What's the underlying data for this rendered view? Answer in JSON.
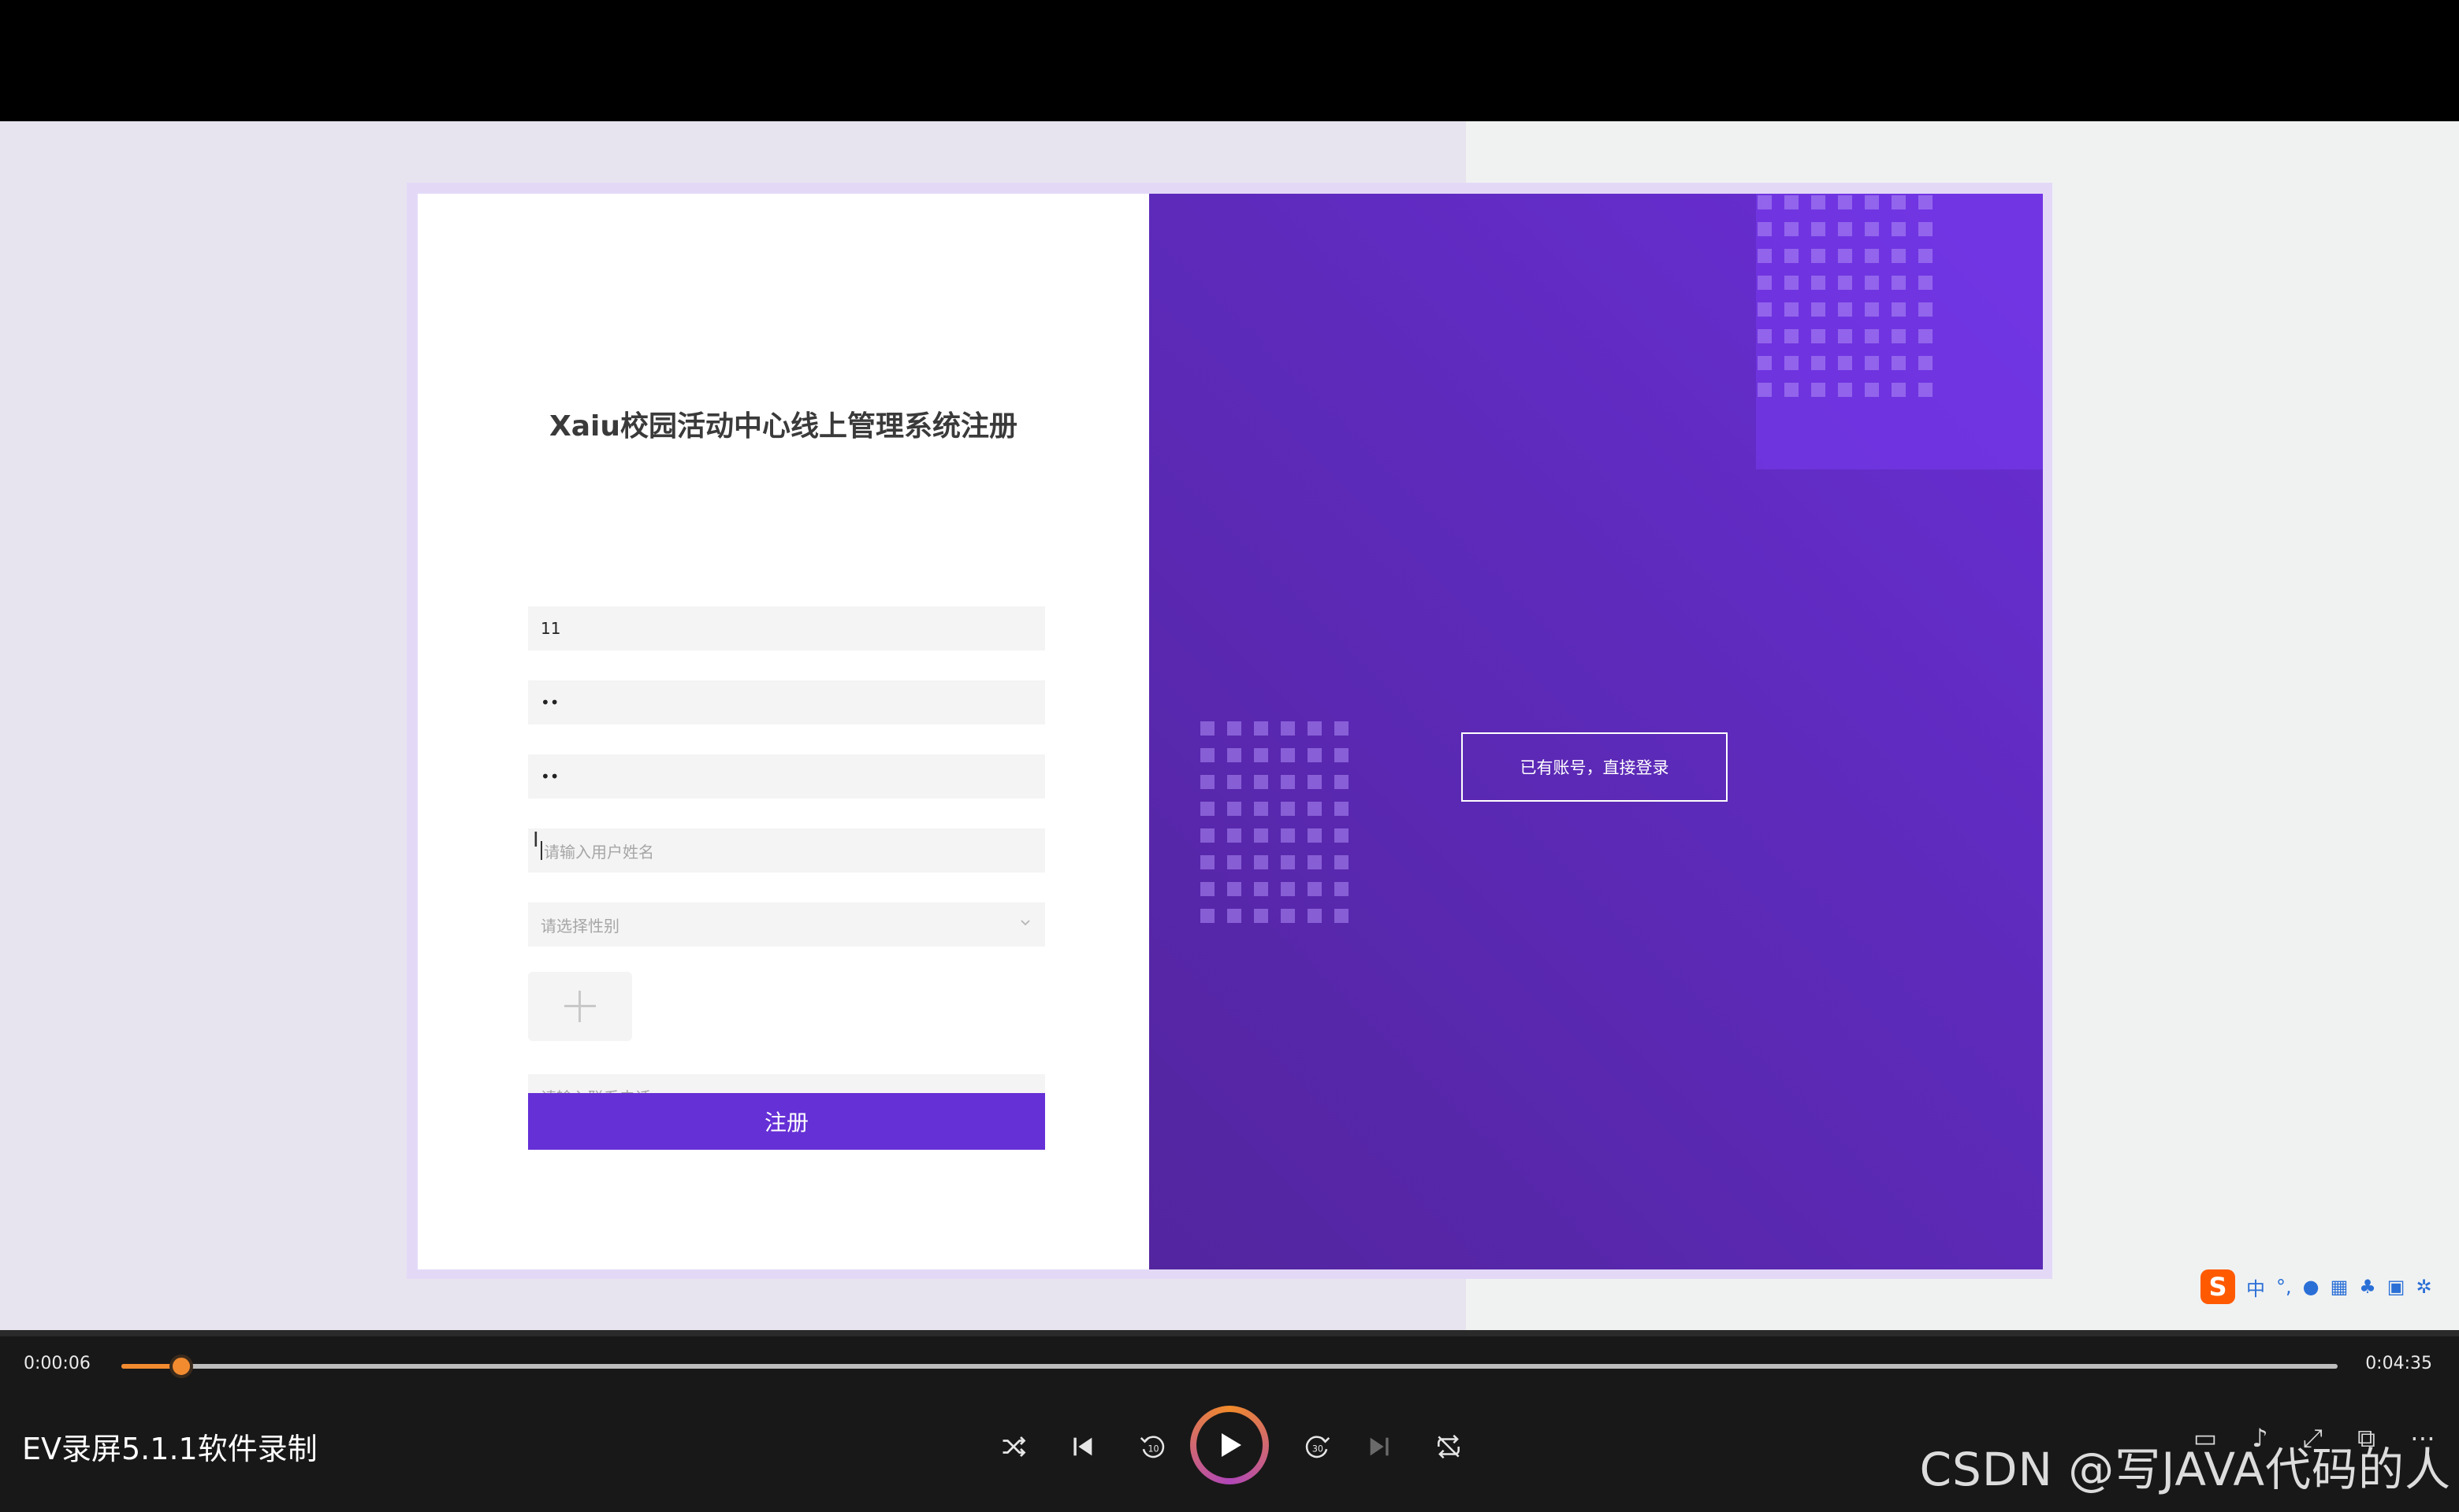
{
  "video": {
    "form": {
      "title": "Xaiu校园活动中心线上管理系统注册",
      "username_value": "11",
      "password_value": "••",
      "confirm_password_value": "••",
      "realname_placeholder": "请输入用户姓名",
      "gender_placeholder": "请选择性别",
      "phone_placeholder": "请输入联系电话",
      "register_label": "注册"
    },
    "side": {
      "login_link_label": "已有账号，直接登录"
    }
  },
  "ime": {
    "logo": "S",
    "mode": "中"
  },
  "player": {
    "current_time": "0:00:06",
    "total_time": "0:04:35",
    "progress": 0.027,
    "title": "EV录屏5.1.1软件录制",
    "colors": {
      "accent": "#f28b30",
      "play_ring": "#b046b8"
    }
  },
  "watermark": "CSDN @写JAVA代码的人"
}
